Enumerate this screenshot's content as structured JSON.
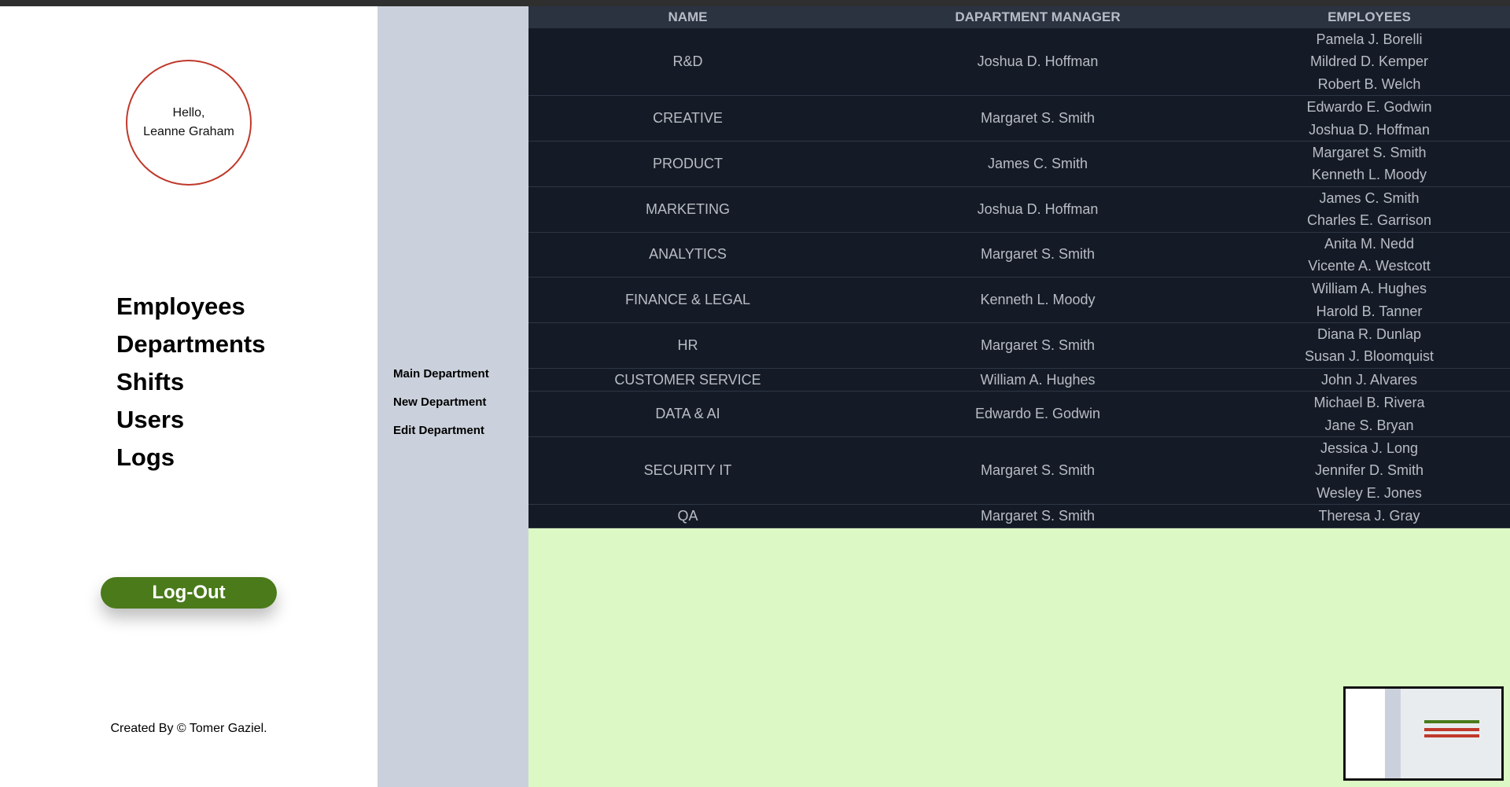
{
  "sidebar": {
    "greeting_line1": "Hello,",
    "greeting_line2": "Leanne Graham",
    "nav": [
      "Employees",
      "Departments",
      "Shifts",
      "Users",
      "Logs"
    ],
    "logout_label": "Log-Out",
    "credit": "Created By © Tomer Gaziel."
  },
  "subnav": {
    "items": [
      "Main Department",
      "New Department",
      "Edit Department"
    ]
  },
  "table": {
    "headers": [
      "NAME",
      "DAPARTMENT MANAGER",
      "EMPLOYEES"
    ],
    "rows": [
      {
        "name": "R&D",
        "manager": "Joshua D. Hoffman",
        "employees": [
          "Pamela J. Borelli",
          "Mildred D. Kemper",
          "Robert B. Welch"
        ]
      },
      {
        "name": "CREATIVE",
        "manager": "Margaret S. Smith",
        "employees": [
          "Edwardo E. Godwin",
          "Joshua D. Hoffman"
        ]
      },
      {
        "name": "PRODUCT",
        "manager": "James C. Smith",
        "employees": [
          "Margaret S. Smith",
          "Kenneth L. Moody"
        ]
      },
      {
        "name": "MARKETING",
        "manager": "Joshua D. Hoffman",
        "employees": [
          "James C. Smith",
          "Charles E. Garrison"
        ]
      },
      {
        "name": "ANALYTICS",
        "manager": "Margaret S. Smith",
        "employees": [
          "Anita M. Nedd",
          "Vicente A. Westcott"
        ]
      },
      {
        "name": "FINANCE & LEGAL",
        "manager": "Kenneth L. Moody",
        "employees": [
          "William A. Hughes",
          "Harold B. Tanner"
        ]
      },
      {
        "name": "HR",
        "manager": "Margaret S. Smith",
        "employees": [
          "Diana R. Dunlap",
          "Susan J. Bloomquist"
        ]
      },
      {
        "name": "CUSTOMER SERVICE",
        "manager": "William A. Hughes",
        "employees": [
          "John J. Alvares"
        ]
      },
      {
        "name": "DATA & AI",
        "manager": "Edwardo E. Godwin",
        "employees": [
          "Michael B. Rivera",
          "Jane S. Bryan"
        ]
      },
      {
        "name": "SECURITY IT",
        "manager": "Margaret S. Smith",
        "employees": [
          "Jessica J. Long",
          "Jennifer D. Smith",
          "Wesley E. Jones"
        ]
      },
      {
        "name": "QA",
        "manager": "Margaret S. Smith",
        "employees": [
          "Theresa J. Gray"
        ]
      }
    ]
  },
  "colors": {
    "accent_green": "#4a7a1a",
    "circle_border": "#c0392b",
    "table_bg": "#151b26",
    "content_bg": "#dcf8c4",
    "subnav_bg": "#cbd1dc"
  }
}
